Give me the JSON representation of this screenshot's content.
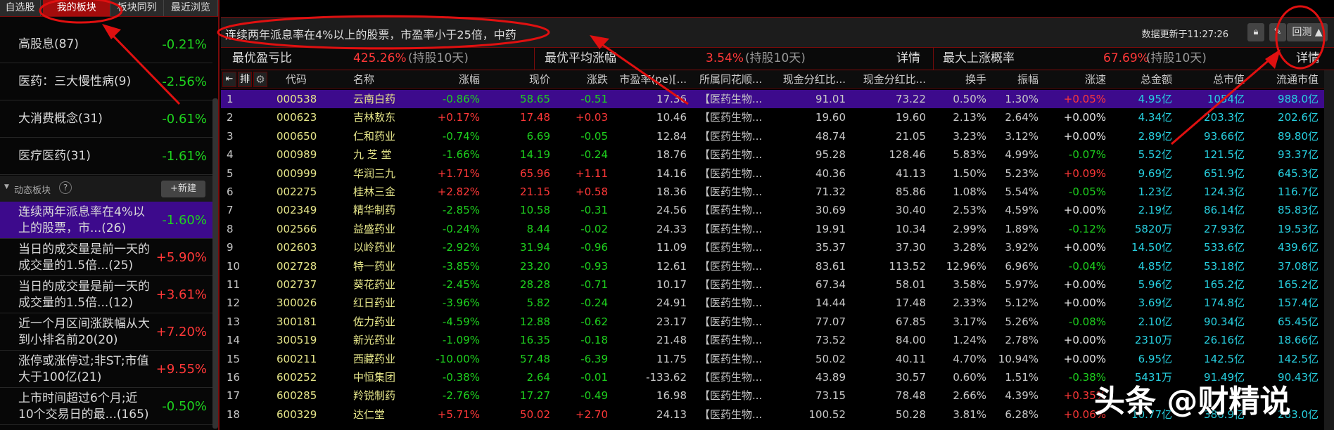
{
  "tabs": [
    "自选股",
    "我的板块",
    "板块同列",
    "最近浏览"
  ],
  "my_blocks": [
    {
      "name": "高股息(87)",
      "pct": "-0.21%",
      "color": "g"
    },
    {
      "name": "医药：三大慢性病(9)",
      "pct": "-2.56%",
      "color": "g"
    },
    {
      "name": "大消费概念(31)",
      "pct": "-0.61%",
      "color": "g"
    },
    {
      "name": "医疗医药(31)",
      "pct": "-1.61%",
      "color": "g"
    }
  ],
  "dynamic_header": {
    "label": "动态板块",
    "help": "?",
    "new_button": "+新建"
  },
  "dynamic_blocks": [
    {
      "name": "连续两年派息率在4%以上的股票，市...(26)",
      "pct": "-1.60%",
      "color": "g"
    },
    {
      "name": "当日的成交量是前一天的成交量的1.5倍...(25)",
      "pct": "+5.90%",
      "color": "r"
    },
    {
      "name": "当日的成交量是前一天的成交量的1.5倍...(12)",
      "pct": "+3.61%",
      "color": "r"
    },
    {
      "name": "近一个月区间涨跌幅从大到小排名前20(20)",
      "pct": "+7.20%",
      "color": "r"
    },
    {
      "name": "涨停或涨停过;非ST;市值大于100亿(21)",
      "pct": "+9.55%",
      "color": "r"
    },
    {
      "name": "上市时间超过6个月;近10个交易日的最...(165)",
      "pct": "-0.50%",
      "color": "g"
    }
  ],
  "title": {
    "query": "连续两年派息率在4%以上的股票，市盈率小于25倍，中药",
    "updated": "数据更新于11:27:26",
    "backtest_button": "回测 ▲"
  },
  "stats": [
    {
      "label": "最优盈亏比",
      "value": "425.26%",
      "hold": "(持股10天)"
    },
    {
      "label": "最优平均涨幅",
      "value": "3.54%",
      "hold": "(持股10天)",
      "detail": "详情"
    },
    {
      "label": "最大上涨概率",
      "value": "67.69%",
      "hold": "(持股10天)",
      "detail": "详情"
    }
  ],
  "header_sort": "排",
  "columns": [
    "代码",
    "名称",
    "涨幅",
    "现价",
    "涨跌",
    "市盈率(pe)[...",
    "所属同花顺...",
    "现金分红比...",
    "现金分红比...",
    "换手",
    "振幅",
    "涨速",
    "总金额",
    "总市值",
    "流通市值"
  ],
  "rows": [
    [
      "1",
      "000538",
      "云南白药",
      "-0.86%",
      "58.65",
      "-0.51",
      "17.36",
      "【医药生物...",
      "91.01",
      "73.22",
      "0.50%",
      "1.30%",
      "+0.05%",
      "4.95亿",
      "1054亿",
      "988.0亿"
    ],
    [
      "2",
      "000623",
      "吉林敖东",
      "+0.17%",
      "17.48",
      "+0.03",
      "10.46",
      "【医药生物...",
      "19.60",
      "19.60",
      "2.13%",
      "2.64%",
      "+0.00%",
      "4.34亿",
      "203.3亿",
      "202.6亿"
    ],
    [
      "3",
      "000650",
      "仁和药业",
      "-0.74%",
      "6.69",
      "-0.05",
      "12.84",
      "【医药生物...",
      "48.74",
      "21.05",
      "3.23%",
      "3.12%",
      "+0.00%",
      "2.89亿",
      "93.66亿",
      "89.80亿"
    ],
    [
      "4",
      "000989",
      "九 芝 堂",
      "-1.66%",
      "14.19",
      "-0.24",
      "18.76",
      "【医药生物...",
      "95.28",
      "128.46",
      "5.83%",
      "4.99%",
      "-0.07%",
      "5.52亿",
      "121.5亿",
      "93.37亿"
    ],
    [
      "5",
      "000999",
      "华润三九",
      "+1.71%",
      "65.96",
      "+1.11",
      "14.16",
      "【医药生物...",
      "40.36",
      "41.13",
      "1.50%",
      "5.23%",
      "+0.09%",
      "9.69亿",
      "651.9亿",
      "645.3亿"
    ],
    [
      "6",
      "002275",
      "桂林三金",
      "+2.82%",
      "21.15",
      "+0.58",
      "18.36",
      "【医药生物...",
      "71.32",
      "85.86",
      "1.08%",
      "5.54%",
      "-0.05%",
      "1.23亿",
      "124.3亿",
      "116.7亿"
    ],
    [
      "7",
      "002349",
      "精华制药",
      "-2.85%",
      "10.58",
      "-0.31",
      "24.56",
      "【医药生物...",
      "30.69",
      "30.40",
      "2.53%",
      "4.59%",
      "+0.00%",
      "2.19亿",
      "86.14亿",
      "85.83亿"
    ],
    [
      "8",
      "002566",
      "益盛药业",
      "-0.24%",
      "8.44",
      "-0.02",
      "24.33",
      "【医药生物...",
      "19.91",
      "10.34",
      "2.99%",
      "1.89%",
      "-0.12%",
      "5820万",
      "27.93亿",
      "19.53亿"
    ],
    [
      "9",
      "002603",
      "以岭药业",
      "-2.92%",
      "31.94",
      "-0.96",
      "11.09",
      "【医药生物...",
      "35.37",
      "37.30",
      "3.28%",
      "3.92%",
      "+0.00%",
      "14.50亿",
      "533.6亿",
      "439.6亿"
    ],
    [
      "10",
      "002728",
      "特一药业",
      "-3.85%",
      "23.20",
      "-0.93",
      "12.61",
      "【医药生物...",
      "83.61",
      "113.52",
      "12.96%",
      "6.96%",
      "-0.04%",
      "4.85亿",
      "53.18亿",
      "37.08亿"
    ],
    [
      "11",
      "002737",
      "葵花药业",
      "-2.45%",
      "28.28",
      "-0.71",
      "10.17",
      "【医药生物...",
      "67.34",
      "58.01",
      "3.58%",
      "5.97%",
      "+0.00%",
      "5.96亿",
      "165.2亿",
      "165.2亿"
    ],
    [
      "12",
      "300026",
      "红日药业",
      "-3.96%",
      "5.82",
      "-0.24",
      "24.91",
      "【医药生物...",
      "14.44",
      "17.48",
      "2.33%",
      "5.12%",
      "+0.00%",
      "3.69亿",
      "174.8亿",
      "157.4亿"
    ],
    [
      "13",
      "300181",
      "佐力药业",
      "-4.59%",
      "12.88",
      "-0.62",
      "23.17",
      "【医药生物...",
      "77.07",
      "67.85",
      "3.17%",
      "5.26%",
      "-0.08%",
      "2.10亿",
      "90.34亿",
      "65.45亿"
    ],
    [
      "14",
      "300519",
      "新光药业",
      "-1.09%",
      "16.35",
      "-0.18",
      "21.48",
      "【医药生物...",
      "73.52",
      "84.00",
      "1.24%",
      "2.78%",
      "+0.00%",
      "2310万",
      "26.16亿",
      "18.66亿"
    ],
    [
      "15",
      "600211",
      "西藏药业",
      "-10.00%",
      "57.48",
      "-6.39",
      "11.75",
      "【医药生物...",
      "50.02",
      "40.11",
      "4.70%",
      "10.94%",
      "+0.00%",
      "6.95亿",
      "142.5亿",
      "142.5亿"
    ],
    [
      "16",
      "600252",
      "中恒集团",
      "-0.38%",
      "2.64",
      "-0.01",
      "-133.62",
      "【医药生物...",
      "43.89",
      "30.57",
      "0.60%",
      "1.51%",
      "-0.38%",
      "5431万",
      "91.49亿",
      "90.43亿"
    ],
    [
      "17",
      "600285",
      "羚锐制药",
      "-2.76%",
      "17.27",
      "-0.49",
      "16.98",
      "【医药生物...",
      "73.15",
      "78.48",
      "2.66%",
      "4.39%",
      "+0.35%",
      "",
      "",
      ""
    ],
    [
      "18",
      "600329",
      "达仁堂",
      "+5.71%",
      "50.02",
      "+2.70",
      "24.13",
      "【医药生物...",
      "100.52",
      "50.28",
      "3.81%",
      "6.28%",
      "+0.06%",
      "10.77亿",
      "386.9亿",
      "283.0亿"
    ]
  ],
  "watermark": "头条 @财精说"
}
